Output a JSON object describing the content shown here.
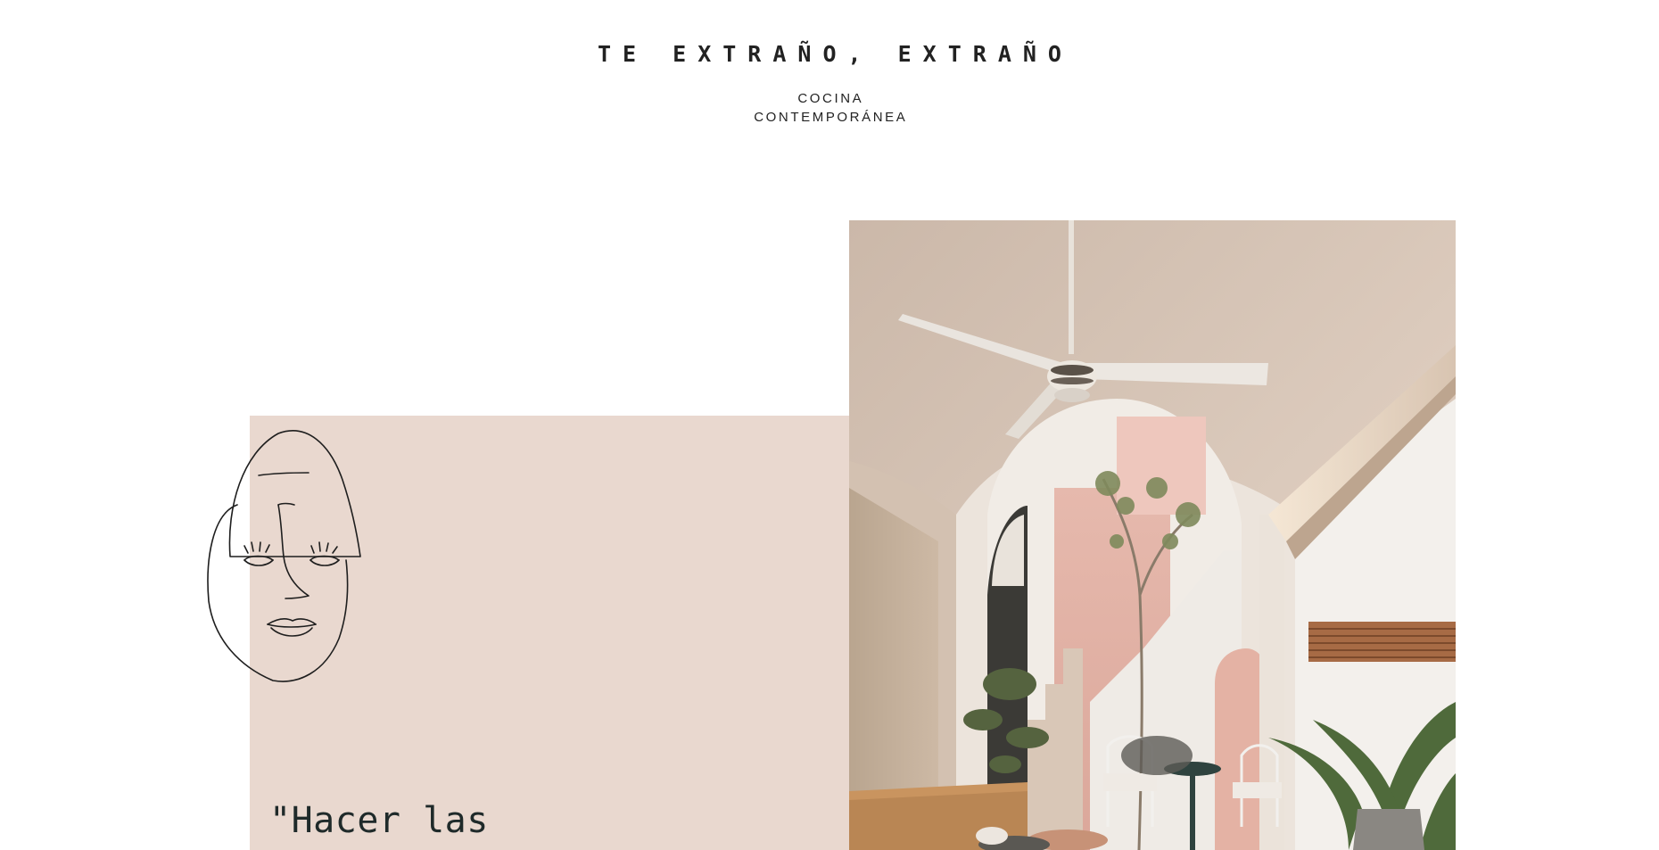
{
  "header": {
    "brand_name": "TE EXTRAÑO, EXTRAÑO",
    "tagline_line1": "COCINA",
    "tagline_line2": "CONTEMPORÁNEA"
  },
  "hero": {
    "quote_text": "\"Hacer las",
    "illustration_icon": "line-drawing-face-icon",
    "photo_subject": "courtyard-interior-photo",
    "panel_color": "#e9d8cf"
  }
}
